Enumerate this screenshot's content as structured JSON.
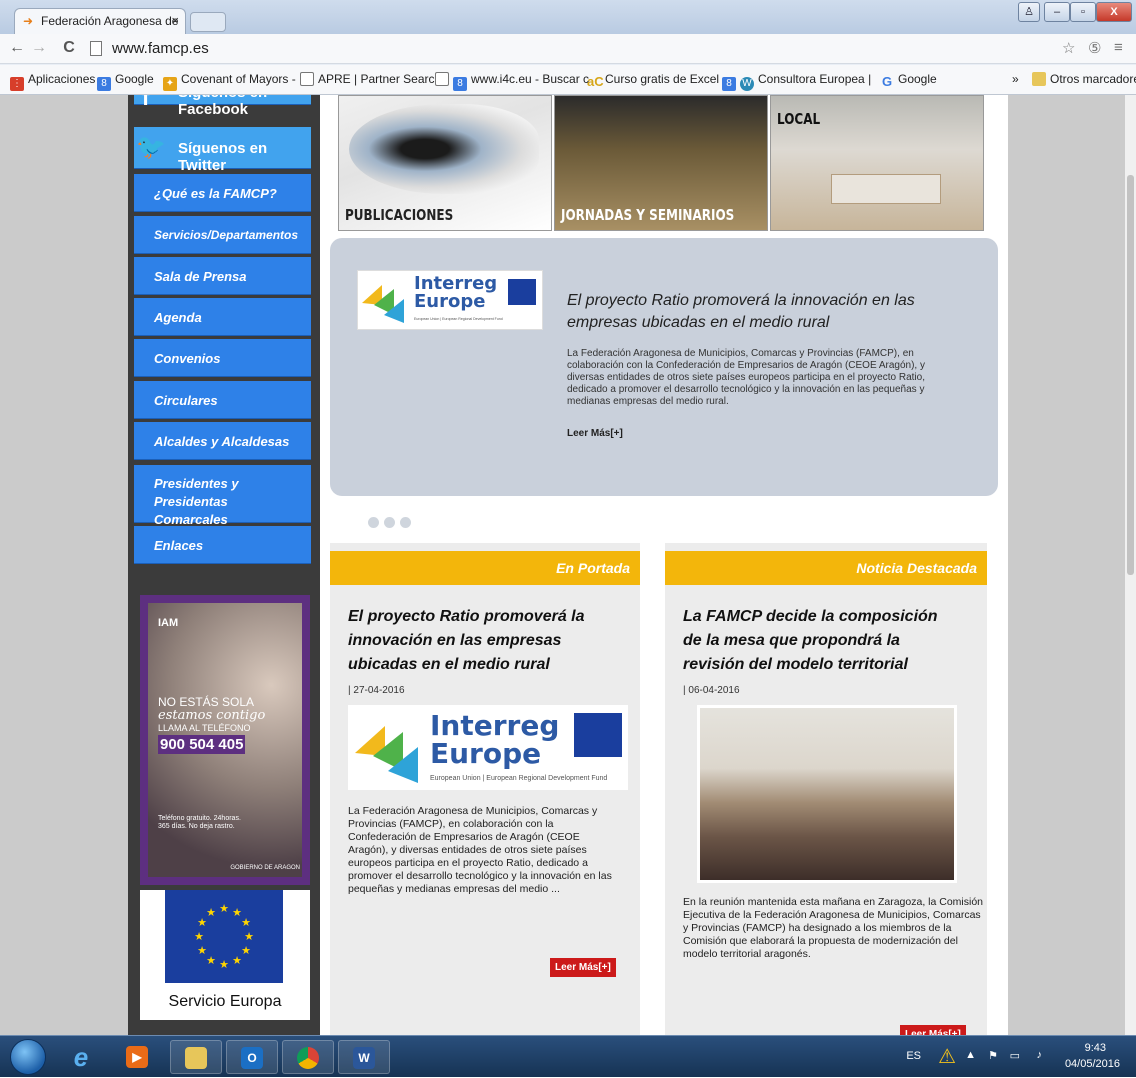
{
  "browser": {
    "tab_title": "Federación Aragonesa de",
    "tab_close": "×",
    "url": "www.famcp.es",
    "bookmarks": [
      {
        "label": "Aplicaciones"
      },
      {
        "label": "Google"
      },
      {
        "label": "Covenant of Mayors -"
      },
      {
        "label": "APRE | Partner Search"
      },
      {
        "label": "www.i4c.eu - Buscar c"
      },
      {
        "label": "Curso gratis de Excel"
      },
      {
        "label": "Consultora Europea |"
      },
      {
        "label": "Google"
      }
    ],
    "bookmarks_more": "»",
    "other_bookmarks": "Otros marcadores"
  },
  "sidebar": {
    "social": [
      {
        "label": "Síguenos en Facebook"
      },
      {
        "label": "Síguenos en Twitter"
      }
    ],
    "items": [
      {
        "label": "¿Qué es la FAMCP?"
      },
      {
        "label": "Servicios/Departamentos"
      },
      {
        "label": "Sala de Prensa"
      },
      {
        "label": "Agenda"
      },
      {
        "label": "Convenios"
      },
      {
        "label": "Circulares"
      },
      {
        "label": "Alcaldes y Alcaldesas"
      },
      {
        "label": "Presidentes y Presidentas Comarcales"
      },
      {
        "label": "Enlaces"
      }
    ],
    "ad": {
      "logo": "IAM",
      "line1": "NO ESTÁS SOLA",
      "line2": "estamos contigo",
      "line3": "LLAMA AL TELÉFONO",
      "phone": "900 504 405",
      "small": "Teléfono gratuito. 24horas. 365 días. No deja rastro.",
      "gob": "GOBIERNO DE ARAGON"
    },
    "europa_label": "Servicio Europa"
  },
  "top_images": [
    {
      "caption": "PUBLICACIONES"
    },
    {
      "caption": "JORNADAS Y SEMINARIOS"
    },
    {
      "caption": "LOCAL"
    }
  ],
  "slider": {
    "logo_word1": "Interreg",
    "logo_word2": "Europe",
    "logo_sub": "European Union | European Regional Development Fund",
    "title": "El proyecto Ratio promoverá la innovación en las empresas ubicadas en el medio rural",
    "text": "La Federación Aragonesa de Municipios, Comarcas y Provincias (FAMCP), en colaboración con la Confederación de Empresarios de Aragón (CEOE Aragón), y diversas entidades de otros siete países europeos participa en el proyecto Ratio, dedicado a promover el desarrollo tecnológico y la innovación en las pequeñas y medianas empresas del medio rural.",
    "more": "Leer Más[+]"
  },
  "cards": [
    {
      "header": "En Portada",
      "title": "El proyecto Ratio promoverá la innovación en las empresas ubicadas en el medio rural",
      "date": "| 27-04-2016",
      "body": "La Federación Aragonesa de Municipios, Comarcas y Provincias (FAMCP), en colaboración con la Confederación de Empresarios de Aragón (CEOE Aragón), y diversas entidades de otros siete países europeos participa en el proyecto Ratio, dedicado a promover el desarrollo tecnológico y la innovación en las pequeñas y medianas empresas del medio ...",
      "more": "Leer Más[+]"
    },
    {
      "header": "Noticia Destacada",
      "title": "La FAMCP decide la composición de la mesa que propondrá la revisión del modelo territorial",
      "date": "| 06-04-2016",
      "body": "En la reunión mantenida esta mañana en Zaragoza, la Comisión Ejecutiva de la Federación Aragonesa de Municipios, Comarcas y Provincias (FAMCP) ha designado a los miembros de la Comisión que elaborará la propuesta de modernización del modelo territorial aragonés.",
      "more": "Leer Más[+]"
    }
  ],
  "taskbar": {
    "lang": "ES",
    "time": "9:43",
    "date": "04/05/2016"
  }
}
